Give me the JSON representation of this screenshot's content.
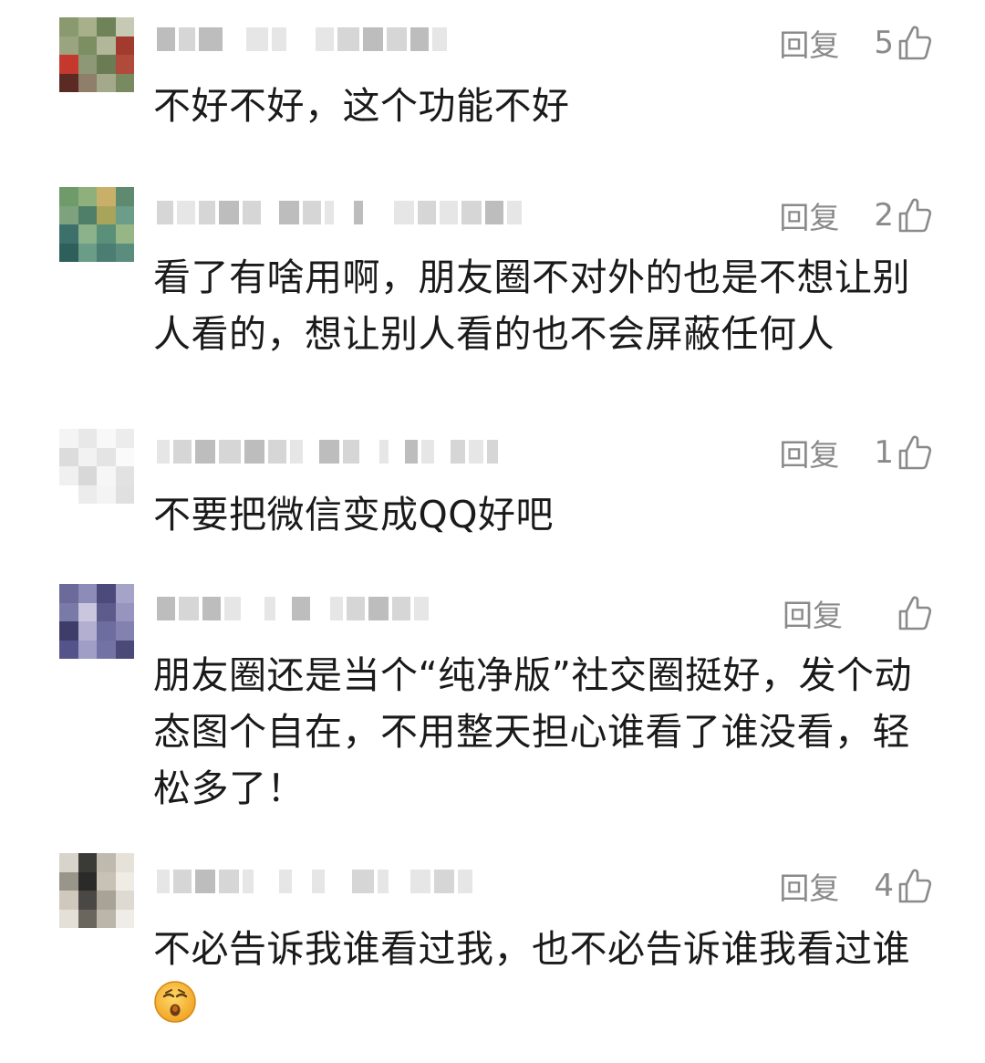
{
  "comments": [
    {
      "reply_label": "回复",
      "likes": "5",
      "text": "不好不好，这个功能不好",
      "avatar_colors": [
        "#8a9a6e",
        "#a7b08a",
        "#6f8358",
        "#c6c9b4",
        "#9aa47f",
        "#7c8f62",
        "#b3b79a",
        "#a33a2e",
        "#c4382e",
        "#8d9976",
        "#6b7b53",
        "#b04a3a",
        "#5b2a22",
        "#8e7e6a",
        "#a4a98c",
        "#7a8a60"
      ]
    },
    {
      "reply_label": "回复",
      "likes": "2",
      "text": "看了有啥用啊，朋友圈不对外的也是不想让别人看的，想让别人看的也不会屏蔽任何人",
      "avatar_colors": [
        "#6f9a6a",
        "#8fb07a",
        "#c8b06a",
        "#5e8a70",
        "#7ea27e",
        "#4f7f68",
        "#a9a45c",
        "#6c9d8a",
        "#3d6f6b",
        "#8bb28a",
        "#5a8f7a",
        "#96b686",
        "#2f5f5a",
        "#6a9c88",
        "#4c7d72",
        "#5a8d7e"
      ]
    },
    {
      "reply_label": "回复",
      "likes": "1",
      "text": "不要把微信变成QQ好吧",
      "avatar_colors": [
        "#f4f4f4",
        "#e8e8e8",
        "#f8f8f8",
        "#ececec",
        "#dcdcdc",
        "#f2f2f2",
        "#e4e4e4",
        "#fafafa",
        "#f0f0f0",
        "#d8d8d8",
        "#f6f6f6",
        "#e2e2e2",
        "#ffffff",
        "#ececec",
        "#f4f4f4",
        "#e0e0e0"
      ]
    },
    {
      "reply_label": "回复",
      "likes": "",
      "text": "朋友圈还是当个“纯净版”社交圈挺好，发个动态图个自在，不用整天担心谁看了谁没看，轻松多了！",
      "avatar_colors": [
        "#6b6a9a",
        "#8d8bb8",
        "#4b4a7a",
        "#a6a3c8",
        "#7a7aa8",
        "#c9c6de",
        "#5c5b8c",
        "#9795c0",
        "#3e3d6a",
        "#b2afd0",
        "#6e6da0",
        "#8281b0",
        "#55548a",
        "#a09ec6",
        "#7372a4",
        "#4a4978"
      ]
    },
    {
      "reply_label": "回复",
      "likes": "4",
      "text": "不必告诉我谁看过我，也不必告诉谁我看过谁",
      "avatar_colors": [
        "#d8d4cc",
        "#3a3a36",
        "#bfb9ae",
        "#e6e2da",
        "#9a958b",
        "#2a2a28",
        "#c8c2b6",
        "#efece6",
        "#cfc9bd",
        "#4a4844",
        "#a9a397",
        "#dedad2",
        "#e4e0d8",
        "#6a665e",
        "#bcb6aa",
        "#f0ede8"
      ]
    }
  ]
}
